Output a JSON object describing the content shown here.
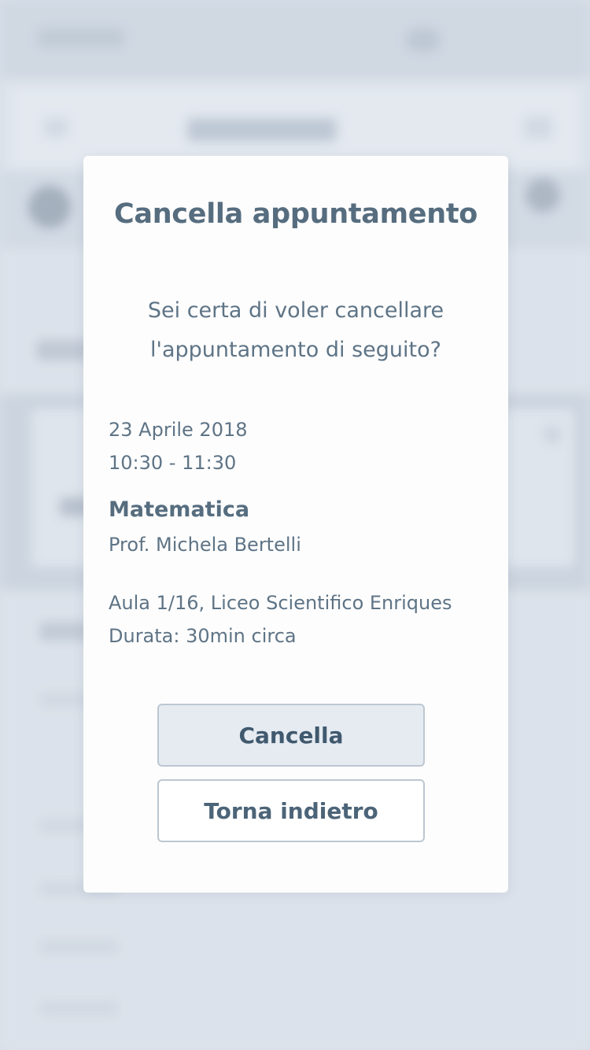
{
  "dialog": {
    "title": "Cancella appuntamento",
    "question_line1": "Sei certa di voler cancellare",
    "question_line2": "l'appuntamento di seguito?",
    "appointment": {
      "date": "23 Aprile 2018",
      "time": "10:30 - 11:30",
      "subject": "Matematica",
      "teacher": "Prof. Michela Bertelli",
      "location": "Aula 1/16, Liceo Scientifico Enriques",
      "duration": "Durata: 30min circa"
    },
    "buttons": {
      "cancel_label": "Cancella",
      "back_label": "Torna indietro"
    }
  },
  "colors": {
    "title": "#566d7f",
    "text": "#5e7486",
    "cancel_button_bg": "#e6ebf2",
    "button_border": "#bcc7d2",
    "backdrop": "#dde3ea"
  }
}
